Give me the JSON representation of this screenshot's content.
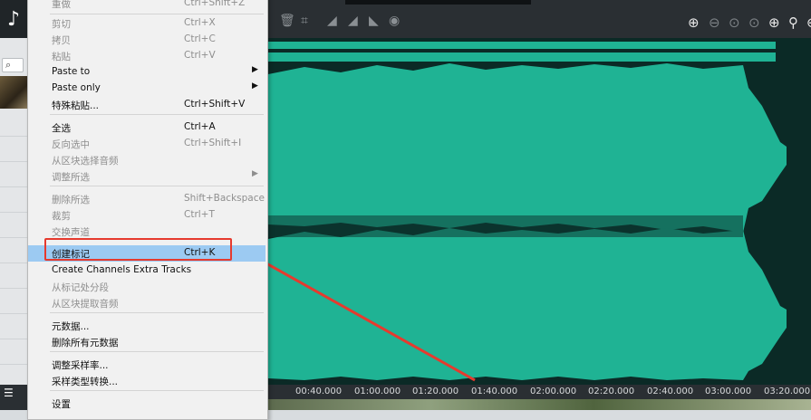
{
  "sidebar": {
    "logo": "♪",
    "search_icon": "search-icon",
    "bottom_icon": "list-icon"
  },
  "menu": {
    "items": [
      {
        "label": "重做",
        "shortcut": "Ctrl+Shift+Z",
        "disabled": true
      },
      {
        "label": "剪切",
        "shortcut": "Ctrl+X",
        "disabled": true
      },
      {
        "label": "拷贝",
        "shortcut": "Ctrl+C",
        "disabled": true
      },
      {
        "label": "粘贴",
        "shortcut": "Ctrl+V",
        "disabled": true
      },
      {
        "label": "Paste to",
        "shortcut": "",
        "disabled": false,
        "submenu": true
      },
      {
        "label": "Paste only",
        "shortcut": "",
        "disabled": false,
        "submenu": true
      },
      {
        "label": "特殊粘贴...",
        "shortcut": "Ctrl+Shift+V",
        "disabled": false
      },
      {
        "label": "全选",
        "shortcut": "Ctrl+A",
        "disabled": false
      },
      {
        "label": "反向选中",
        "shortcut": "Ctrl+Shift+I",
        "disabled": true
      },
      {
        "label": "从区块选择音频",
        "shortcut": "",
        "disabled": true
      },
      {
        "label": "调整所选",
        "shortcut": "",
        "disabled": true,
        "submenu": true
      },
      {
        "label": "删除所选",
        "shortcut": "Shift+Backspace",
        "disabled": true
      },
      {
        "label": "裁剪",
        "shortcut": "Ctrl+T",
        "disabled": true
      },
      {
        "label": "交换声道",
        "shortcut": "",
        "disabled": true
      },
      {
        "label": "创建标记",
        "shortcut": "Ctrl+K",
        "disabled": false,
        "highlighted": true
      },
      {
        "label": "Create Channels Extra Tracks",
        "shortcut": "",
        "disabled": false
      },
      {
        "label": "从标记处分段",
        "shortcut": "",
        "disabled": true
      },
      {
        "label": "从区块提取音频",
        "shortcut": "",
        "disabled": true
      },
      {
        "label": "元数据...",
        "shortcut": "",
        "disabled": false
      },
      {
        "label": "删除所有元数据",
        "shortcut": "",
        "disabled": false
      },
      {
        "label": "调整采样率...",
        "shortcut": "",
        "disabled": false
      },
      {
        "label": "采样类型转换...",
        "shortcut": "",
        "disabled": false
      },
      {
        "label": "设置",
        "shortcut": "",
        "disabled": false
      }
    ]
  },
  "toolbar": {
    "tools": [
      "trash-icon",
      "crop-icon",
      "fade-in-icon",
      "fade-out-icon",
      "normalize-icon"
    ],
    "zoom": [
      "zoom-in-icon",
      "zoom-out-icon",
      "zoom-selection-icon",
      "zoom-fit-icon",
      "zoom-full-icon",
      "zoom-vertical-icon",
      "zoom-reset-icon"
    ]
  },
  "timeline": {
    "labels": [
      "00:40.000",
      "01:00.000",
      "01:20.000",
      "01:40.000",
      "02:00.000",
      "02:20.000",
      "02:40.000",
      "03:00.000",
      "03:20.000"
    ]
  },
  "colors": {
    "waveform": "#1fb394",
    "wave_bg": "#0b2a26",
    "highlight": "#9ccaf2",
    "annotation": "#e63a2e"
  }
}
